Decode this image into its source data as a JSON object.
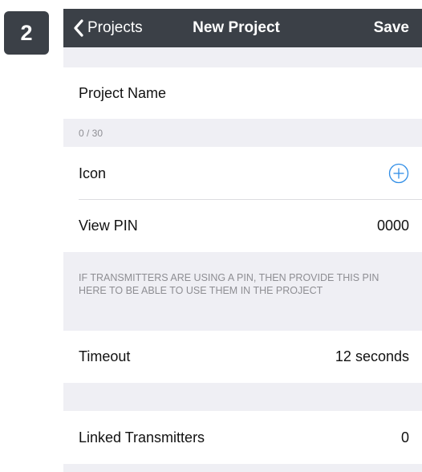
{
  "step": {
    "number": "2"
  },
  "navbar": {
    "back_label": "Projects",
    "title": "New Project",
    "save_label": "Save"
  },
  "form": {
    "project_name_placeholder": "Project Name",
    "project_name_counter": "0 / 30",
    "icon_label": "Icon",
    "view_pin_label": "View PIN",
    "view_pin_value": "0000",
    "pin_note": "IF TRANSMITTERS ARE USING A PIN, THEN PROVIDE THIS PIN HERE TO BE ABLE TO USE THEM IN THE PROJECT",
    "timeout_label": "Timeout",
    "timeout_value": "12 seconds",
    "linked_transmitters_label": "Linked Transmitters",
    "linked_transmitters_value": "0"
  },
  "colors": {
    "navbar_bg": "#3b4047",
    "accent": "#2f8de6",
    "group_bg": "#efeff4"
  },
  "icons": {
    "back": "chevron-left-icon",
    "add": "circle-plus-icon"
  }
}
